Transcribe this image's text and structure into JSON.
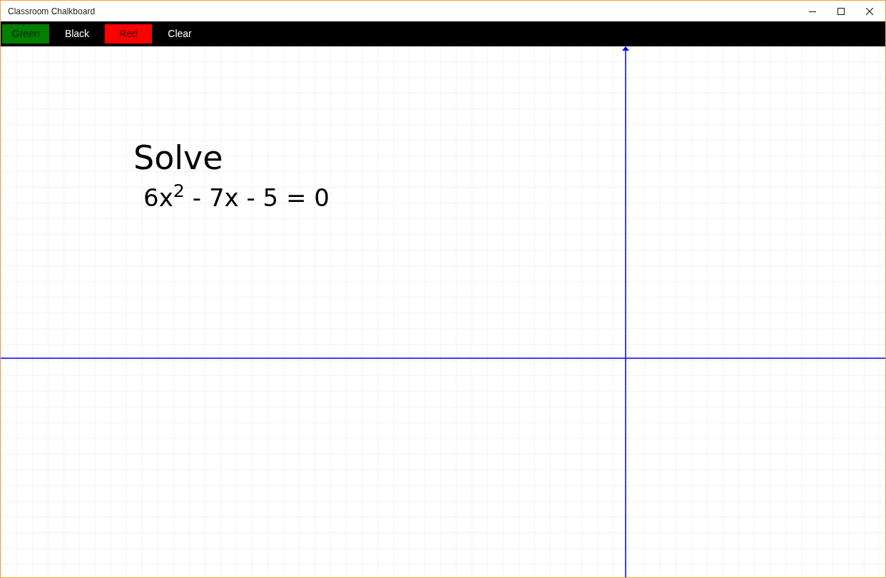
{
  "window": {
    "title": "Classroom Chalkboard"
  },
  "toolbar": {
    "buttons": [
      {
        "label": "Green",
        "color": "#008000"
      },
      {
        "label": "Black",
        "color": "#000000"
      },
      {
        "label": "Red",
        "color": "#ff0000"
      },
      {
        "label": "Clear"
      }
    ]
  },
  "board": {
    "ink": [
      {
        "text": "Solve"
      },
      {
        "text": "6x$^{2}$ - 7x - 5 = 0"
      }
    ]
  }
}
